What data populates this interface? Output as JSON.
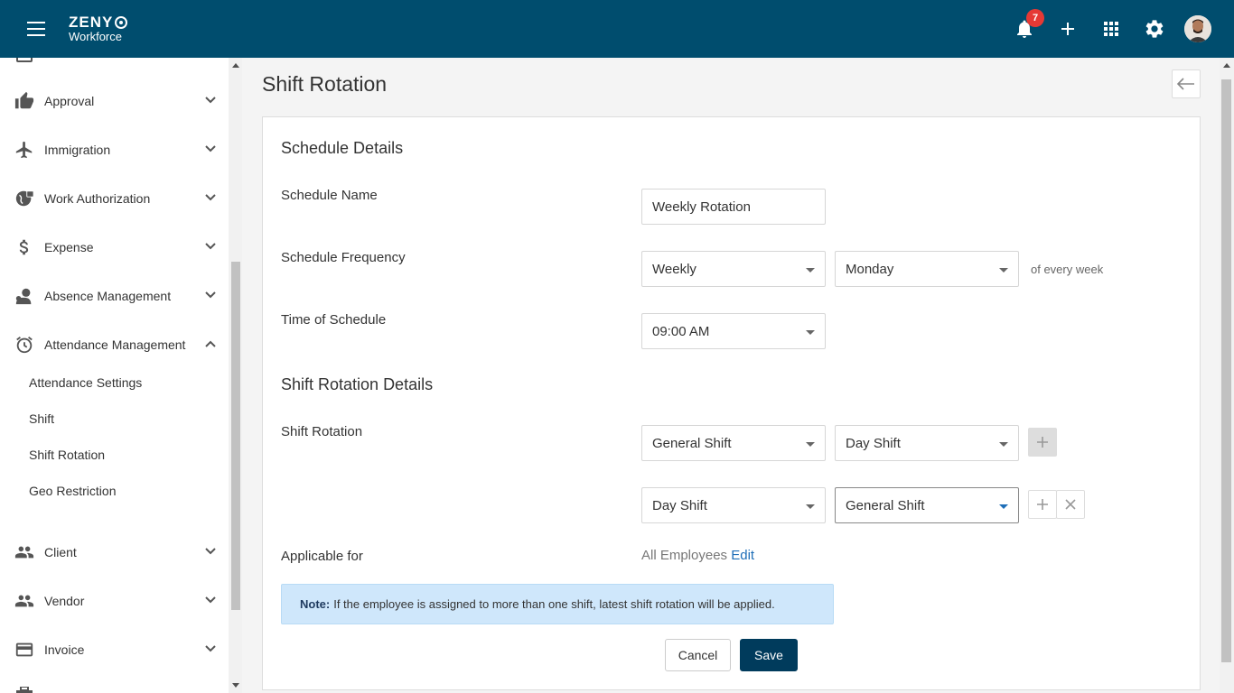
{
  "header": {
    "brand": "ZENY",
    "brand_sub": "Workforce",
    "notification_count": "7",
    "accent_color": "#004d6e"
  },
  "sidebar": {
    "items": [
      {
        "label": "Approval",
        "icon": "thumbs-up-icon"
      },
      {
        "label": "Immigration",
        "icon": "airplane-icon"
      },
      {
        "label": "Work Authorization",
        "icon": "globe-lock-icon"
      },
      {
        "label": "Expense",
        "icon": "dollar-icon"
      },
      {
        "label": "Absence Management",
        "icon": "person-icon"
      },
      {
        "label": "Attendance Management",
        "icon": "alarm-clock-icon"
      },
      {
        "label": "Client",
        "icon": "people-icon"
      },
      {
        "label": "Vendor",
        "icon": "people-icon"
      },
      {
        "label": "Invoice",
        "icon": "credit-card-icon"
      }
    ],
    "attendance_sub": [
      "Attendance Settings",
      "Shift",
      "Shift Rotation",
      "Geo Restriction"
    ]
  },
  "page": {
    "title": "Shift Rotation"
  },
  "schedule": {
    "section_title": "Schedule Details",
    "name_label": "Schedule Name",
    "name_value": "Weekly Rotation",
    "frequency_label": "Schedule Frequency",
    "frequency_value": "Weekly",
    "day_value": "Monday",
    "frequency_suffix": "of every week",
    "time_label": "Time of Schedule",
    "time_value": "09:00 AM"
  },
  "rotation": {
    "section_title": "Shift Rotation Details",
    "label": "Shift Rotation",
    "rows": [
      {
        "from": "General Shift",
        "to": "Day Shift"
      },
      {
        "from": "Day Shift",
        "to": "General Shift"
      }
    ],
    "applicable_label": "Applicable for",
    "applicable_value": "All Employees",
    "edit_label": "Edit"
  },
  "note": {
    "prefix": "Note:",
    "text": "If the employee is assigned to more than one shift, latest shift rotation will be applied."
  },
  "actions": {
    "cancel_label": "Cancel",
    "save_label": "Save"
  }
}
